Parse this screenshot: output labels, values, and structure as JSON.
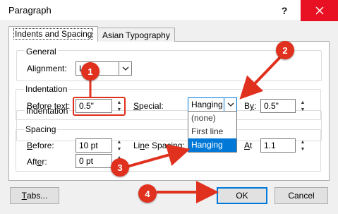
{
  "window": {
    "title": "Paragraph",
    "help_label": "?"
  },
  "tabs": [
    {
      "label": "Indents and Spacing",
      "active": true
    },
    {
      "label": "Asian Typography",
      "active": false
    }
  ],
  "general": {
    "title": "General",
    "alignment_label_pre": "Ali",
    "alignment_label_u": "g",
    "alignment_label_post": "nment:",
    "alignment_value": "Left"
  },
  "indentation": {
    "title": "Indentation",
    "before_label_pre": "Before te",
    "before_label_u": "x",
    "before_label_post": "t:",
    "before_value": "0.5\"",
    "special_label_pre": "",
    "special_label_u": "S",
    "special_label_post": "pecial:",
    "special_value": "Hanging",
    "by_label_pre": "B",
    "by_label_u": "y",
    "by_label_post": ":",
    "by_value": "0.5\""
  },
  "special_options": [
    "(none)",
    "First line",
    "Hanging"
  ],
  "spacing": {
    "title": "Spacing",
    "before_label_pre": "",
    "before_label_u": "B",
    "before_label_post": "efore:",
    "before_value": "10 pt",
    "after_label_pre": "Aft",
    "after_label_u": "e",
    "after_label_post": "r:",
    "after_value": "0 pt",
    "line_label_pre": "Li",
    "line_label_u": "n",
    "line_label_post": "e Spacing:",
    "at_label_pre": "",
    "at_label_u": "A",
    "at_label_post": "t",
    "at_value": "1.1"
  },
  "buttons": {
    "tabs_u": "T",
    "tabs_post": "abs...",
    "ok": "OK",
    "cancel": "Cancel"
  },
  "callouts": [
    "1",
    "2",
    "3",
    "4"
  ],
  "colors": {
    "callout": "#e0301e",
    "accent": "#0078d7",
    "close": "#e81123"
  }
}
